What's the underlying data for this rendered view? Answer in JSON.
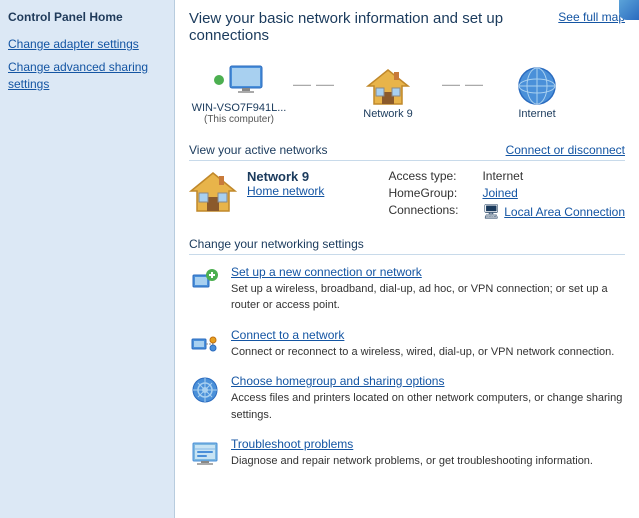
{
  "sidebar": {
    "title": "Control Panel Home",
    "links": [
      {
        "id": "adapter-settings",
        "label": "Change adapter settings"
      },
      {
        "id": "advanced-sharing",
        "label": "Change advanced sharing settings"
      }
    ]
  },
  "main": {
    "title": "View your basic network information and set up connections",
    "see_full_map": "See full map",
    "diagram": {
      "computer": {
        "name": "WIN-VSO7F941L...",
        "sublabel": "(This computer)"
      },
      "network": {
        "name": "Network  9"
      },
      "internet": {
        "name": "Internet"
      }
    },
    "active_networks": {
      "section_label": "View your active networks",
      "connect_label": "Connect or disconnect",
      "network_name": "Network  9",
      "network_type": "Home network",
      "access_type_label": "Access type:",
      "access_type_value": "Internet",
      "homegroup_label": "HomeGroup:",
      "homegroup_value": "Joined",
      "connections_label": "Connections:",
      "connections_value": "Local Area Connection"
    },
    "change_settings": {
      "section_label": "Change your networking settings",
      "items": [
        {
          "id": "new-connection",
          "link": "Set up a new connection or network",
          "desc": "Set up a wireless, broadband, dial-up, ad hoc, or VPN connection; or set up a router or access point."
        },
        {
          "id": "connect-network",
          "link": "Connect to a network",
          "desc": "Connect or reconnect to a wireless, wired, dial-up, or VPN network connection."
        },
        {
          "id": "homegroup",
          "link": "Choose homegroup and sharing options",
          "desc": "Access files and printers located on other network computers, or change sharing settings."
        },
        {
          "id": "troubleshoot",
          "link": "Troubleshoot problems",
          "desc": "Diagnose and repair network problems, or get troubleshooting information."
        }
      ]
    }
  }
}
